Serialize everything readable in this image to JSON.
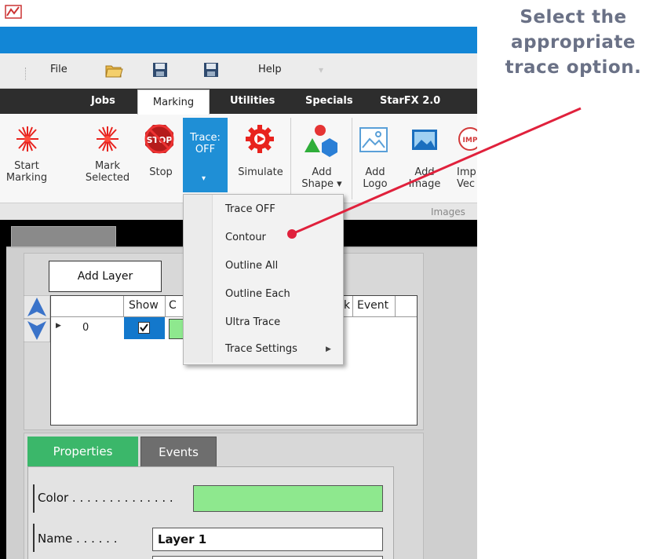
{
  "menu": {
    "file": "File",
    "help": "Help"
  },
  "tabs": {
    "jobs": "Jobs",
    "marking": "Marking",
    "utilities": "Utilities",
    "specials": "Specials",
    "starfx": "StarFX 2.0"
  },
  "ribbon": {
    "start_marking": [
      "Start",
      "Marking"
    ],
    "mark_selected": [
      "Mark",
      "Selected"
    ],
    "stop": "Stop",
    "trace": [
      "Trace:",
      "OFF"
    ],
    "simulate": "Simulate",
    "add_shape": [
      "Add",
      "Shape ▾"
    ],
    "add_logo": [
      "Add",
      "Logo"
    ],
    "add_image": [
      "Add",
      "Image"
    ],
    "import_vector": [
      "Imp",
      "Vec"
    ],
    "group_label": "Images"
  },
  "trace_menu": {
    "items": [
      "Trace OFF",
      "Contour",
      "Outline All",
      "Outline Each",
      "Ultra Trace",
      "Trace Settings"
    ]
  },
  "layers": {
    "add_layer": "Add Layer",
    "columns": {
      "show": "Show",
      "c": "C",
      "k": "k",
      "event": "Event"
    },
    "row_index": "0"
  },
  "properties": {
    "tab_properties": "Properties",
    "tab_events": "Events",
    "color_label": "Color . . . . . . . . . . . . . .",
    "name_label": "Name . . . . . .",
    "name_value": "Layer 1",
    "layer_color": "#8ee88e"
  },
  "callout": {
    "lines": [
      "Select the",
      "appropriate",
      "trace option."
    ],
    "color": "#e0213c"
  }
}
